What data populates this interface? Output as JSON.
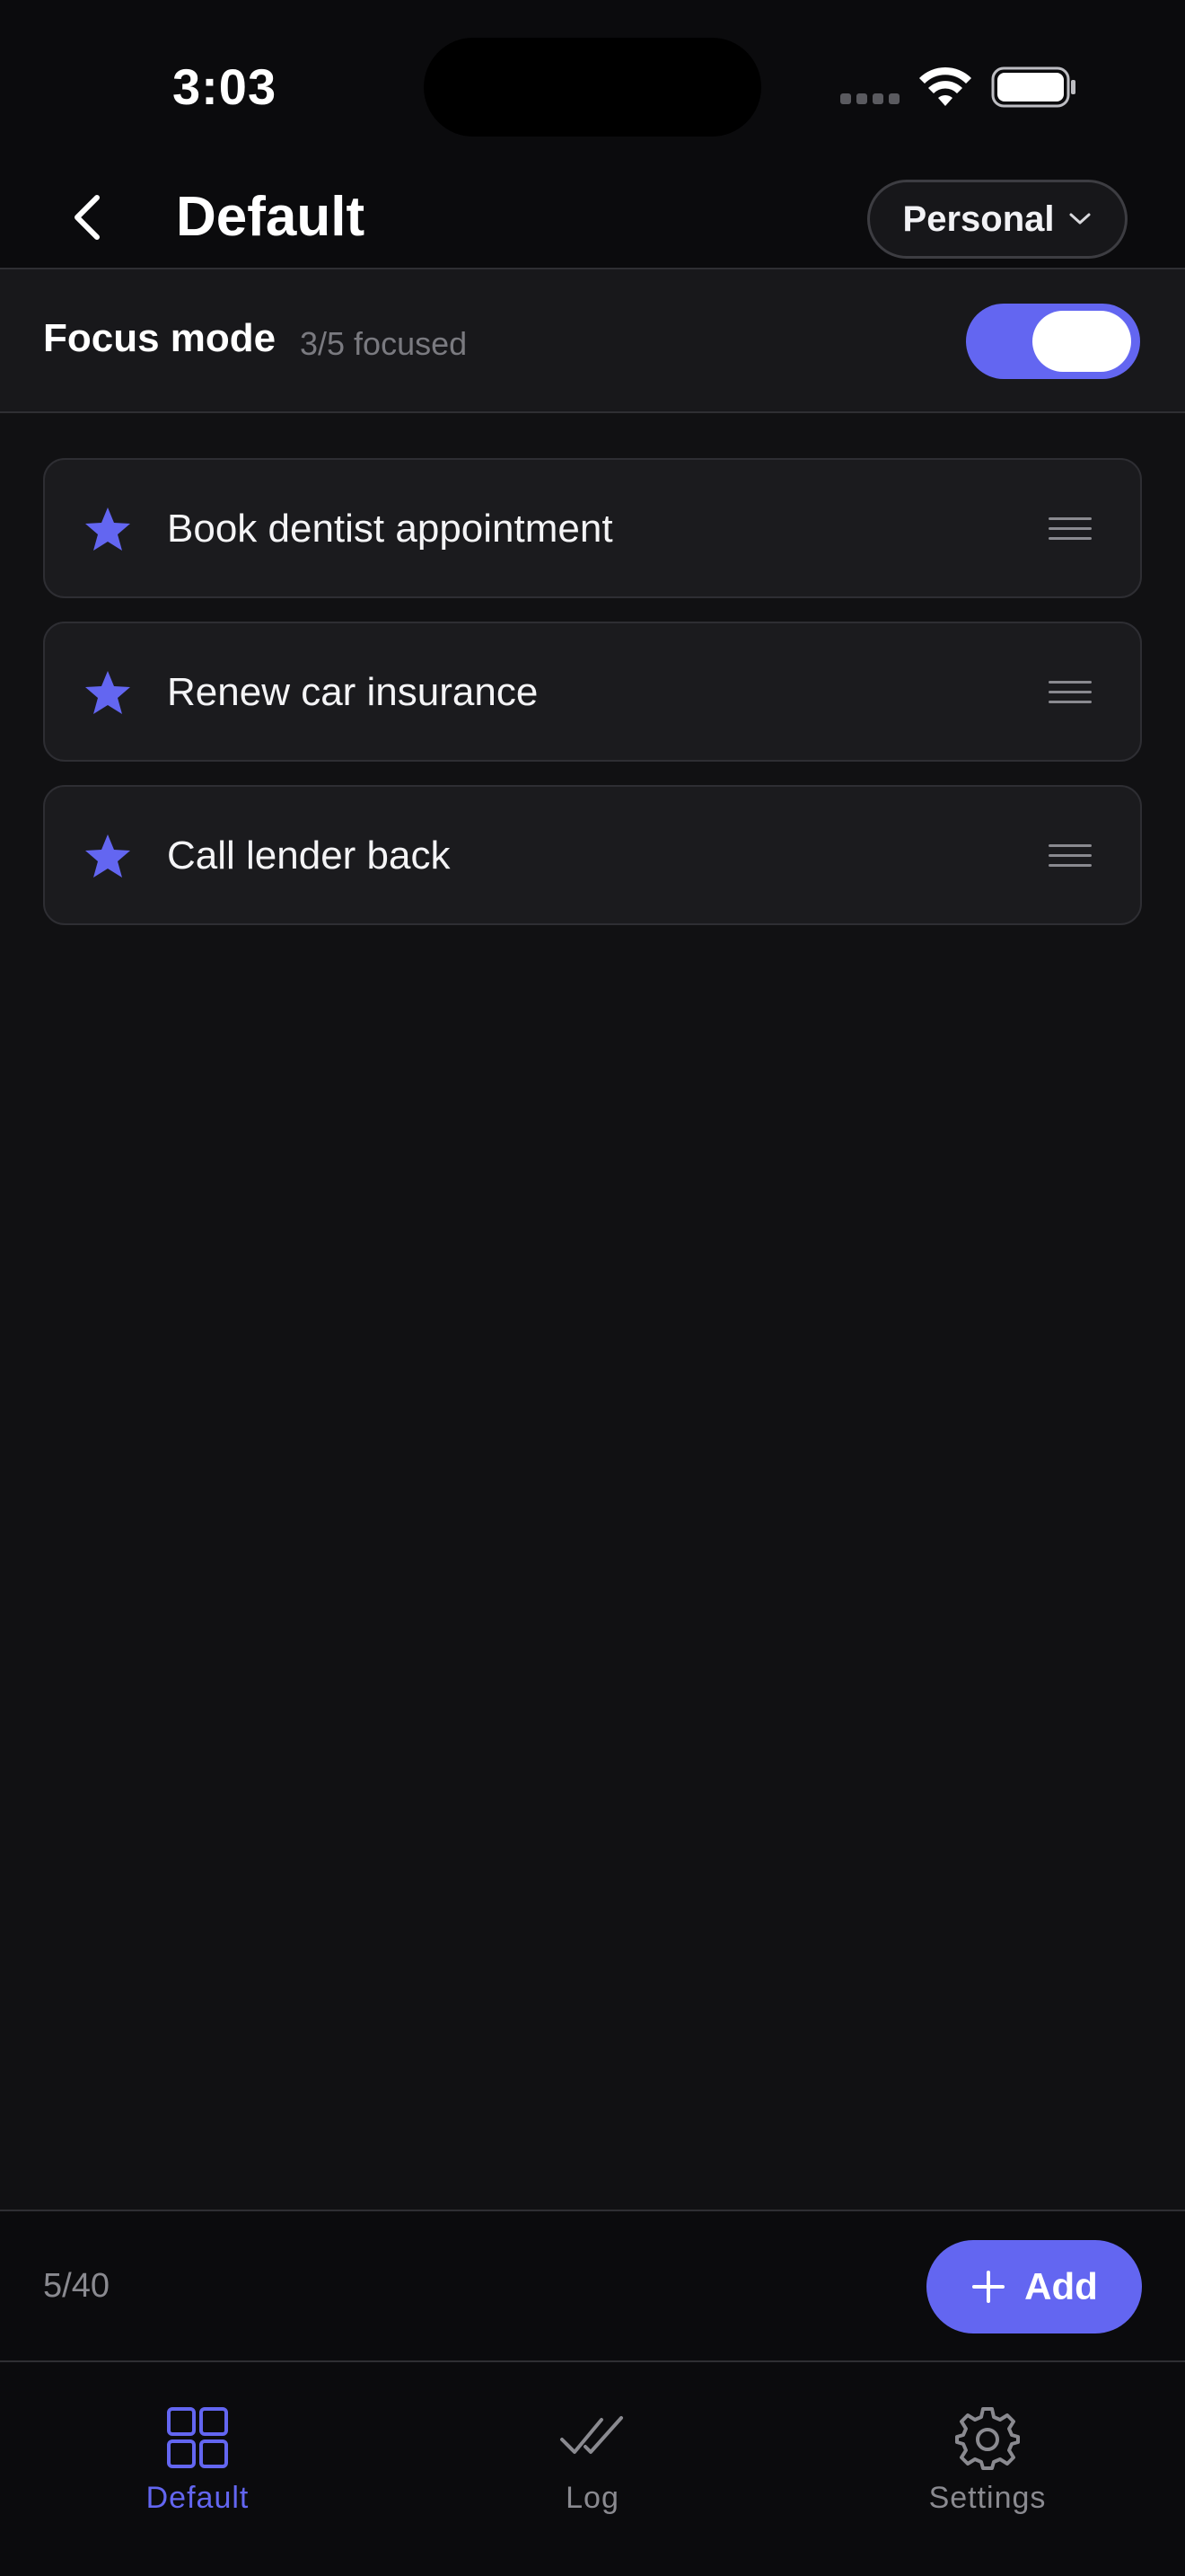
{
  "status_bar": {
    "time": "3:03"
  },
  "header": {
    "title": "Default",
    "profile_selector": "Personal"
  },
  "focus_mode": {
    "label": "Focus mode",
    "count_text": "3/5 focused",
    "enabled": true
  },
  "tasks": [
    {
      "label": "Book dentist appointment",
      "starred": true
    },
    {
      "label": "Renew car insurance",
      "starred": true
    },
    {
      "label": "Call lender back",
      "starred": true
    }
  ],
  "footer": {
    "count": "5/40",
    "add_label": "Add"
  },
  "tab_bar": {
    "items": [
      {
        "label": "Default",
        "icon": "grid-icon",
        "active": true
      },
      {
        "label": "Log",
        "icon": "double-check-icon",
        "active": false
      },
      {
        "label": "Settings",
        "icon": "gear-icon",
        "active": false
      }
    ]
  },
  "colors": {
    "accent": "#6366f1",
    "background": "#111113",
    "card": "#1b1b1e"
  }
}
